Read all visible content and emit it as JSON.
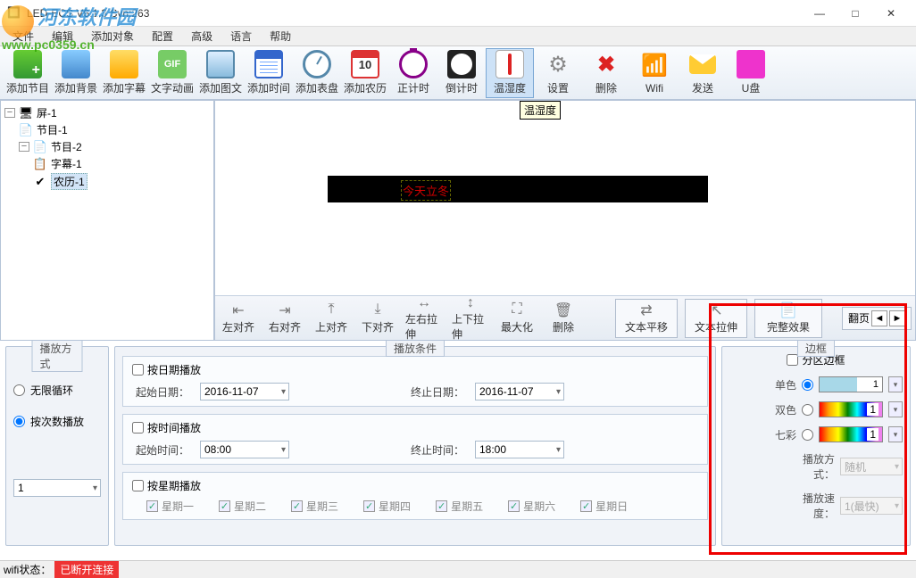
{
  "window": {
    "title": "LED-ECS V6.1.3 Svn:263",
    "minimize": "—",
    "maximize": "□",
    "close": "✕"
  },
  "watermark": {
    "text": "河东软件园",
    "url": "www.pc0359.cn"
  },
  "menu": {
    "file": "文件",
    "edit": "编辑",
    "addobj": "添加对象",
    "config": "配置",
    "advanced": "高级",
    "language": "语言",
    "help": "帮助"
  },
  "toolbar": {
    "addprog": "添加节目",
    "addbg": "添加背景",
    "addsub": "添加字幕",
    "addtext": "文字动画",
    "addimg": "添加图文",
    "addtime": "添加时间",
    "addclock": "添加表盘",
    "addlunar": "添加农历",
    "timerup": "正计时",
    "timerdown": "倒计时",
    "temphumid": "温湿度",
    "settings": "设置",
    "delete": "删除",
    "wifi": "Wifi",
    "send": "发送",
    "usb": "U盘",
    "gif_badge": "GIF"
  },
  "tooltip": "温湿度",
  "tree": {
    "root": "屏-1",
    "prog1": "节目-1",
    "prog2": "节目-2",
    "sub1": "字幕-1",
    "lunar1": "农历-1"
  },
  "canvas": {
    "led_text": "今天立冬"
  },
  "canvas_toolbar": {
    "align_left": "左对齐",
    "align_right": "右对齐",
    "align_top": "上对齐",
    "align_bottom": "下对齐",
    "stretch_h": "左右拉伸",
    "stretch_v": "上下拉伸",
    "maximize": "最大化",
    "delete": "删除",
    "text_pan": "文本平移",
    "text_stretch": "文本拉伸",
    "full_effect": "完整效果",
    "page": "翻页"
  },
  "playmode": {
    "legend": "播放方式",
    "infinite": "无限循环",
    "bycount": "按次数播放",
    "count_value": "1"
  },
  "playcond": {
    "legend": "播放条件",
    "bydate": "按日期播放",
    "start_date_lbl": "起始日期：",
    "start_date": "2016-11-07",
    "end_date_lbl": "终止日期：",
    "end_date": "2016-11-07",
    "bytime": "按时间播放",
    "start_time_lbl": "起始时间：",
    "start_time": "08:00",
    "end_time_lbl": "终止时间：",
    "end_time": "18:00",
    "byweek": "按星期播放",
    "mon": "星期一",
    "tue": "星期二",
    "wed": "星期三",
    "thu": "星期四",
    "fri": "星期五",
    "sat": "星期六",
    "sun": "星期日"
  },
  "border": {
    "legend": "边框",
    "zone_border": "分区边框",
    "single": "单色",
    "double": "双色",
    "rainbow": "七彩",
    "value": "1",
    "playmode_lbl": "播放方式：",
    "playmode_val": "随机",
    "speed_lbl": "播放速度：",
    "speed_val": "1(最快)"
  },
  "status": {
    "label": "wifi状态：",
    "value": "已断开连接"
  }
}
